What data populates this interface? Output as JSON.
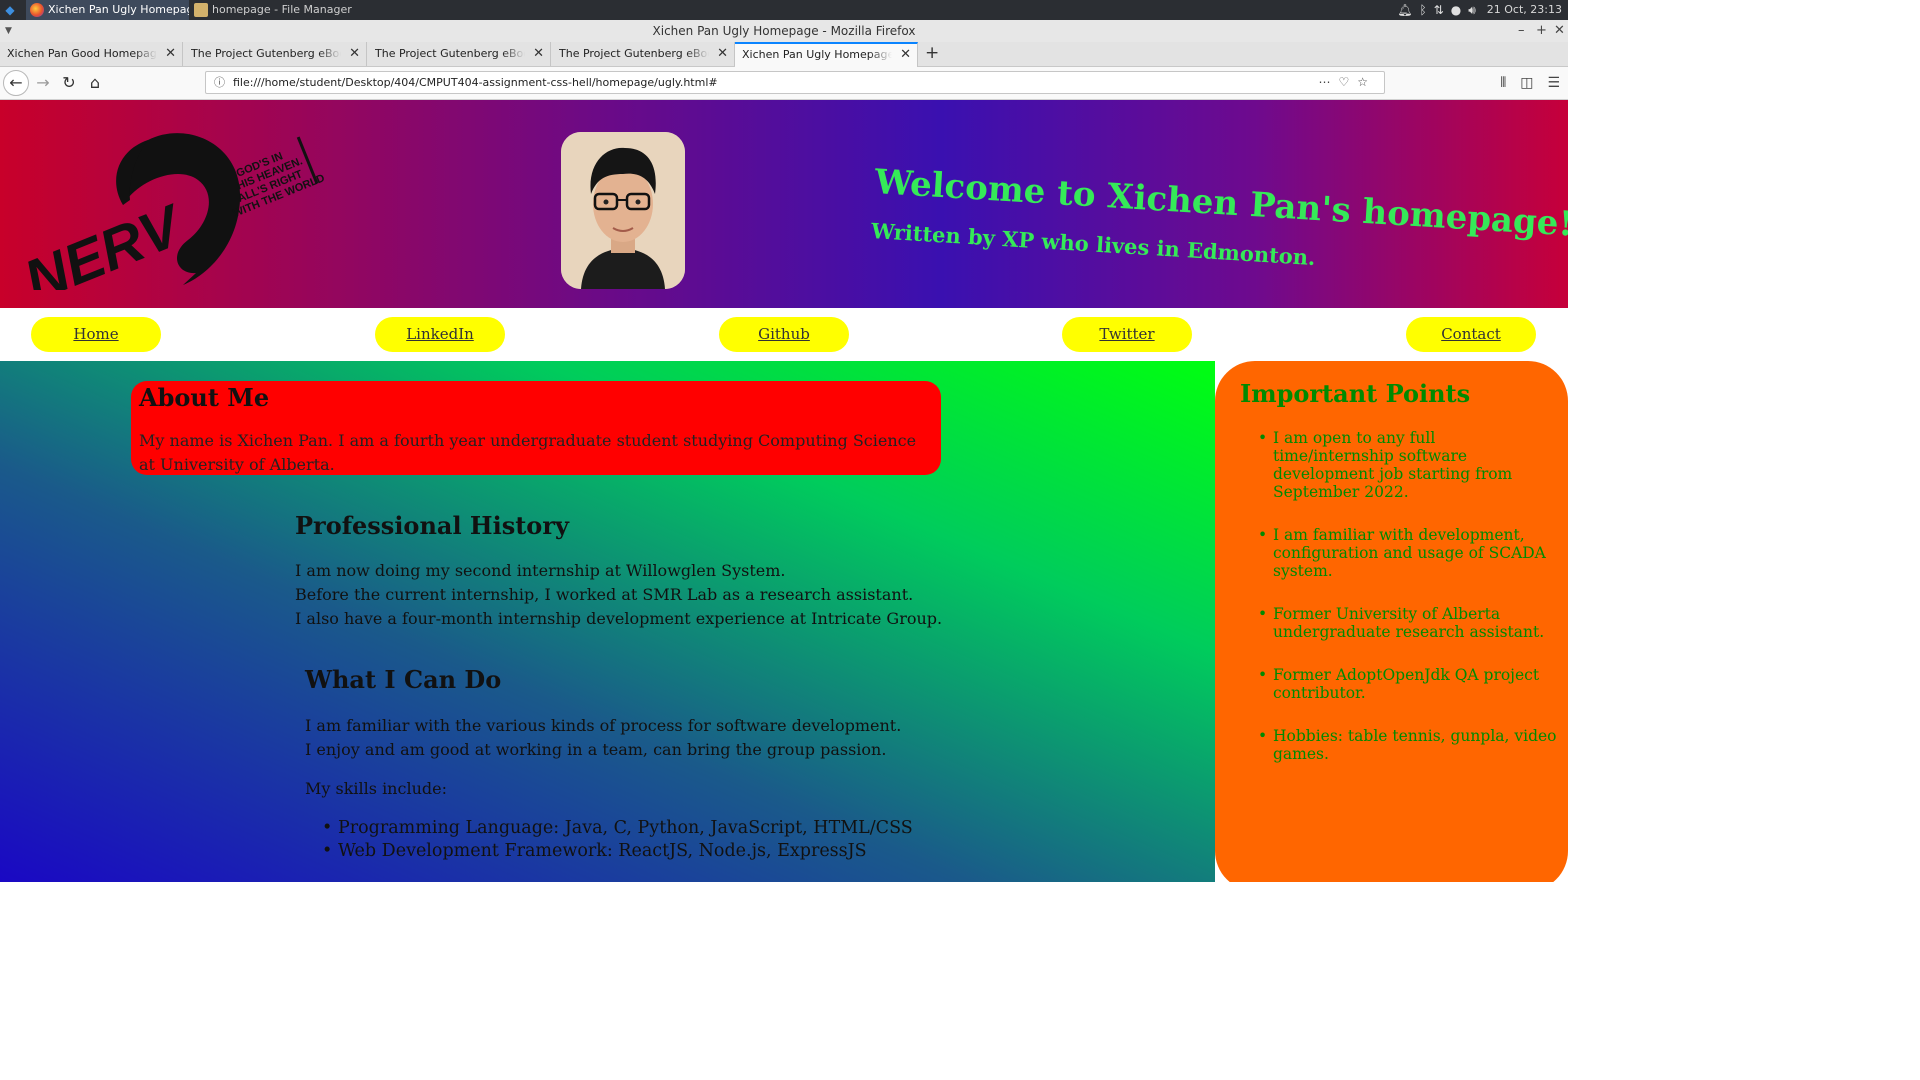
{
  "taskbar": {
    "tasks": [
      "Xichen Pan Ugly Homepage -...",
      "homepage - File Manager"
    ],
    "clock": "21 Oct, 23:13"
  },
  "browser": {
    "window_title": "Xichen Pan Ugly Homepage - Mozilla Firefox",
    "tabs": [
      {
        "label": "Xichen Pan Good Homepage"
      },
      {
        "label": "The Project Gutenberg eBook of A"
      },
      {
        "label": "The Project Gutenberg eBook of D"
      },
      {
        "label": "The Project Gutenberg eBook of F"
      },
      {
        "label": "Xichen Pan Ugly Homepage"
      }
    ],
    "url": "file:///home/student/Desktop/404/CMPUT404-assignment-css-hell/homepage/ugly.html#"
  },
  "header": {
    "logo_text": "NERV",
    "logo_motto": [
      "GOD'S IN",
      "HIS HEAVEN.",
      "ALL'S RIGHT",
      "WITH THE WORLD"
    ],
    "title": "Welcome to Xichen Pan's homepage!",
    "subtitle": "Written by XP who lives in Edmonton."
  },
  "nav": {
    "items": [
      "Home",
      "LinkedIn",
      "Github",
      "Twitter",
      "Contact"
    ]
  },
  "about": {
    "heading": "About Me",
    "text": "My name is Xichen Pan. I am a fourth year undergraduate student studying Computing Science at University of Alberta."
  },
  "professional": {
    "heading": "Professional History",
    "lines": [
      "I am now doing my second internship at Willowglen System.",
      "Before the current internship, I worked at SMR Lab as a research assistant.",
      "I also have a four-month internship development experience at Intricate Group."
    ]
  },
  "can_do": {
    "heading": "What I Can Do",
    "lines": [
      "I am familiar with the various kinds of process for software development.",
      "I enjoy and am good at working in a team, can bring the group passion."
    ],
    "skills_intro": "My skills include:",
    "skills": [
      "Programming Language: Java, C, Python, JavaScript, HTML/CSS",
      "Web Development Framework: ReactJS, Node.js, ExpressJS"
    ]
  },
  "important": {
    "heading": "Important Points",
    "items": [
      "I am open to any full time/internship software development job starting from September 2022.",
      "I am familiar with development, configuration and usage of SCADA system.",
      "Former University of Alberta undergraduate research assistant.",
      "Former AdoptOpenJdk QA project contributor.",
      "Hobbies: table tennis, gunpla, video games."
    ]
  },
  "colors": {
    "header_gradient": [
      "#c8002a",
      "#3a10b0",
      "#c6003a"
    ],
    "nav_pill": "#ffff00",
    "about_box": "#ff0000",
    "important_box": "#ff6600",
    "important_text": "#008a00",
    "welcome_text": "#35ea58"
  }
}
